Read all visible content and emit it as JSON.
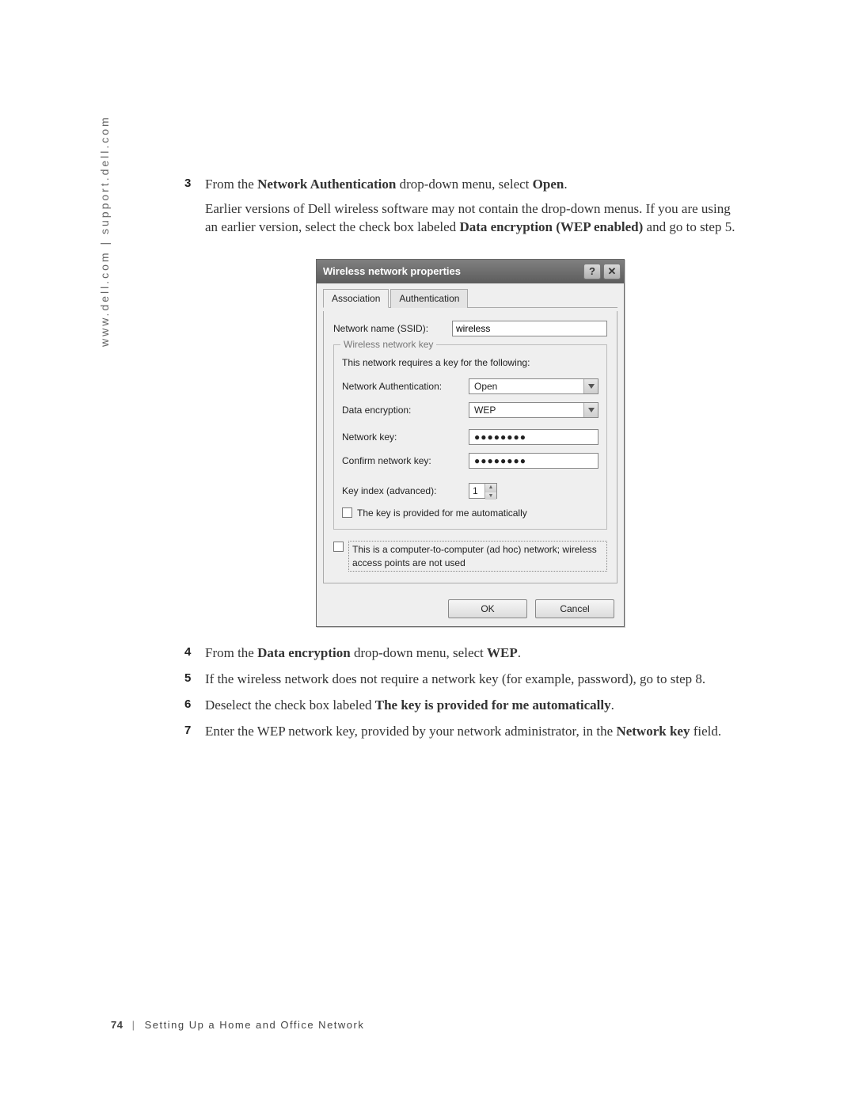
{
  "side_text": "www.dell.com | support.dell.com",
  "steps": {
    "s3": {
      "num": "3",
      "pre": "From the ",
      "b1": "Network Authentication",
      "mid": " drop-down menu, select ",
      "b2": "Open",
      "post": ".",
      "p2a": "Earlier versions of Dell wireless software may not contain the drop-down menus. If you are using an earlier version, select the check box labeled ",
      "p2b": "Data encryption (WEP enabled)",
      "p2c": " and go to step 5."
    },
    "s4": {
      "num": "4",
      "pre": "From the ",
      "b1": "Data encryption",
      "mid": " drop-down menu, select ",
      "b2": "WEP",
      "post": "."
    },
    "s5": {
      "num": "5",
      "text": "If the wireless network does not require a network key (for example, password), go to step 8."
    },
    "s6": {
      "num": "6",
      "pre": "Deselect the check box labeled ",
      "b1": "The key is provided for me automatically",
      "post": "."
    },
    "s7": {
      "num": "7",
      "pre": "Enter the WEP network key, provided by your network administrator, in the ",
      "b1": "Network key",
      "post": " field."
    }
  },
  "dialog": {
    "title": "Wireless network properties",
    "help_glyph": "?",
    "close_glyph": "✕",
    "tabs": {
      "association": "Association",
      "authentication": "Authentication"
    },
    "ssid_label": "Network name (SSID):",
    "ssid_value": "wireless",
    "fieldset_legend": "Wireless network key",
    "fieldset_note": "This network requires a key for the following:",
    "auth_label": "Network Authentication:",
    "auth_value": "Open",
    "enc_label": "Data encryption:",
    "enc_value": "WEP",
    "key_label": "Network key:",
    "key_value": "●●●●●●●●",
    "confirm_label": "Confirm network key:",
    "confirm_value": "●●●●●●●●",
    "index_label": "Key index (advanced):",
    "index_value": "1",
    "autokey_label": "The key is provided for me automatically",
    "adhoc_label": "This is a computer-to-computer (ad hoc) network; wireless access points are not used",
    "ok": "OK",
    "cancel": "Cancel"
  },
  "footer": {
    "page_number": "74",
    "section": "Setting Up a Home and Office Network"
  }
}
